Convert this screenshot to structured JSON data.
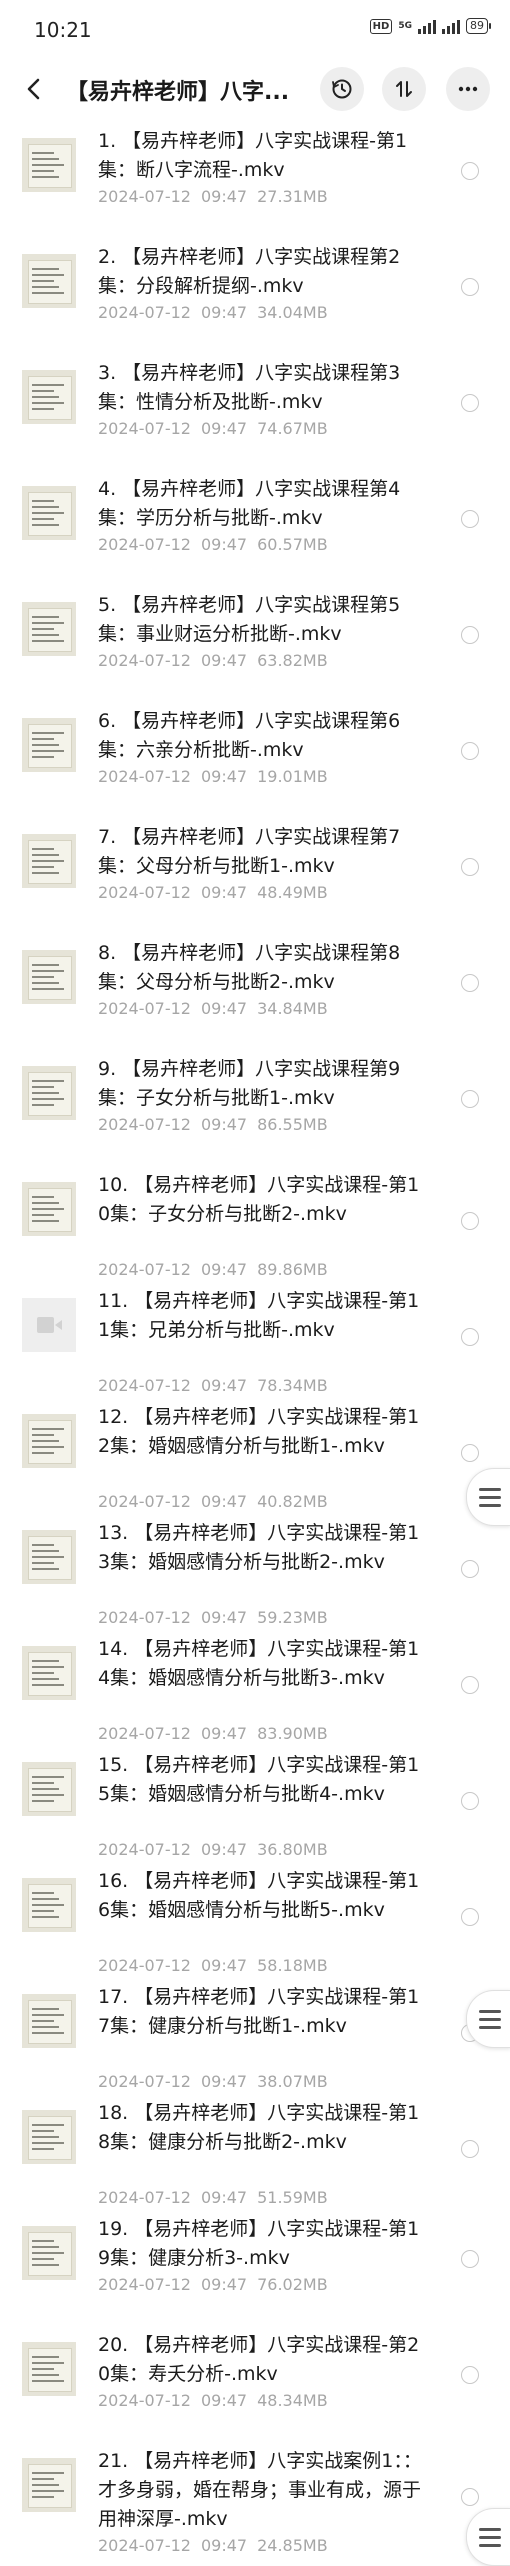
{
  "status_bar": {
    "time": "10:21",
    "hd": "HD",
    "network": "5G",
    "battery": "89"
  },
  "header": {
    "title": "【易卉梓老师】八字..."
  },
  "files": [
    {
      "name": "1. 【易卉梓老师】八字实战课程-第1集：断八字流程-.mkv",
      "date": "2024-07-12",
      "time": "09:47",
      "size": "27.31MB",
      "thumb": "doc"
    },
    {
      "name": "2. 【易卉梓老师】八字实战课程第2集：分段解析提纲-.mkv",
      "date": "2024-07-12",
      "time": "09:47",
      "size": "34.04MB",
      "thumb": "doc"
    },
    {
      "name": "3. 【易卉梓老师】八字实战课程第3集：性情分析及批断-.mkv",
      "date": "2024-07-12",
      "time": "09:47",
      "size": "74.67MB",
      "thumb": "doc"
    },
    {
      "name": "4. 【易卉梓老师】八字实战课程第4集：学历分析与批断-.mkv",
      "date": "2024-07-12",
      "time": "09:47",
      "size": "60.57MB",
      "thumb": "doc"
    },
    {
      "name": "5. 【易卉梓老师】八字实战课程第5集：事业财运分析批断-.mkv",
      "date": "2024-07-12",
      "time": "09:47",
      "size": "63.82MB",
      "thumb": "doc"
    },
    {
      "name": "6. 【易卉梓老师】八字实战课程第6集：六亲分析批断-.mkv",
      "date": "2024-07-12",
      "time": "09:47",
      "size": "19.01MB",
      "thumb": "doc"
    },
    {
      "name": "7. 【易卉梓老师】八字实战课程第7集：父母分析与批断1-.mkv",
      "date": "2024-07-12",
      "time": "09:47",
      "size": "48.49MB",
      "thumb": "doc"
    },
    {
      "name": "8. 【易卉梓老师】八字实战课程第8集：父母分析与批断2-.mkv",
      "date": "2024-07-12",
      "time": "09:47",
      "size": "34.84MB",
      "thumb": "doc"
    },
    {
      "name": "9. 【易卉梓老师】八字实战课程第9集：子女分析与批断1-.mkv",
      "date": "2024-07-12",
      "time": "09:47",
      "size": "86.55MB",
      "thumb": "doc"
    },
    {
      "name": "10. 【易卉梓老师】八字实战课程-第10集：子女分析与批断2-.mkv",
      "date": "2024-07-12",
      "time": "09:47",
      "size": "89.86MB",
      "thumb": "doc"
    },
    {
      "name": "11. 【易卉梓老师】八字实战课程-第11集：兄弟分析与批断-.mkv",
      "date": "2024-07-12",
      "time": "09:47",
      "size": "78.34MB",
      "thumb": "video"
    },
    {
      "name": "12. 【易卉梓老师】八字实战课程-第12集：婚姻感情分析与批断1-.mkv",
      "date": "2024-07-12",
      "time": "09:47",
      "size": "40.82MB",
      "thumb": "doc"
    },
    {
      "name": "13. 【易卉梓老师】八字实战课程-第13集：婚姻感情分析与批断2-.mkv",
      "date": "2024-07-12",
      "time": "09:47",
      "size": "59.23MB",
      "thumb": "doc"
    },
    {
      "name": "14. 【易卉梓老师】八字实战课程-第14集：婚姻感情分析与批断3-.mkv",
      "date": "2024-07-12",
      "time": "09:47",
      "size": "83.90MB",
      "thumb": "doc"
    },
    {
      "name": "15. 【易卉梓老师】八字实战课程-第15集：婚姻感情分析与批断4-.mkv",
      "date": "2024-07-12",
      "time": "09:47",
      "size": "36.80MB",
      "thumb": "doc"
    },
    {
      "name": "16. 【易卉梓老师】八字实战课程-第16集：婚姻感情分析与批断5-.mkv",
      "date": "2024-07-12",
      "time": "09:47",
      "size": "58.18MB",
      "thumb": "doc"
    },
    {
      "name": "17. 【易卉梓老师】八字实战课程-第17集：健康分析与批断1-.mkv",
      "date": "2024-07-12",
      "time": "09:47",
      "size": "38.07MB",
      "thumb": "doc"
    },
    {
      "name": "18. 【易卉梓老师】八字实战课程-第18集：健康分析与批断2-.mkv",
      "date": "2024-07-12",
      "time": "09:47",
      "size": "51.59MB",
      "thumb": "doc"
    },
    {
      "name": "19. 【易卉梓老师】八字实战课程-第19集：健康分析3-.mkv",
      "date": "2024-07-12",
      "time": "09:47",
      "size": "76.02MB",
      "thumb": "doc"
    },
    {
      "name": "20. 【易卉梓老师】八字实战课程-第20集：寿夭分析-.mkv",
      "date": "2024-07-12",
      "time": "09:47",
      "size": "48.34MB",
      "thumb": "doc"
    },
    {
      "name": "21. 【易卉梓老师】八字实战案例1：：才多身弱，婚在帮身；事业有成，源于用神深厚-.mkv",
      "date": "2024-07-12",
      "time": "09:47",
      "size": "24.85MB",
      "thumb": "doc"
    }
  ],
  "colors": {
    "meta_text": "#a6a6a6",
    "button_bg": "#eeeeee",
    "radio_border": "#c8c8c8"
  },
  "icons": {
    "back": "arrow-left-icon",
    "history": "clock-history-icon",
    "sort": "sort-arrows-icon",
    "more": "more-dots-icon",
    "floating": "hamburger-menu-icon"
  }
}
